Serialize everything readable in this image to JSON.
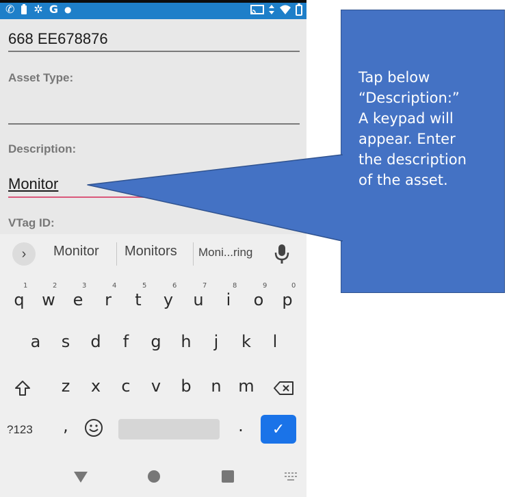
{
  "status_bar": {
    "left_icons": [
      "phone-icon",
      "battery-saver-icon",
      "gear-icon",
      "google-icon",
      "dot-icon"
    ],
    "google_letter": "G",
    "right_icons": [
      "cast-icon",
      "data-transfer-icon",
      "wifi-icon",
      "battery-icon"
    ]
  },
  "form": {
    "serial_value": "668 EE678876",
    "asset_type_label": "Asset Type:",
    "asset_type_value": "",
    "description_label": "Description:",
    "description_value": "Monitor",
    "vtag_label": "VTag ID:"
  },
  "keyboard": {
    "suggestions": [
      "Monitor",
      "Monitors",
      "Moni...ring"
    ],
    "row1": [
      "q",
      "w",
      "e",
      "r",
      "t",
      "y",
      "u",
      "i",
      "o",
      "p"
    ],
    "row1_hints": [
      "1",
      "2",
      "3",
      "4",
      "5",
      "6",
      "7",
      "8",
      "9",
      "0"
    ],
    "row2": [
      "a",
      "s",
      "d",
      "f",
      "g",
      "h",
      "j",
      "k",
      "l"
    ],
    "row3": [
      "z",
      "x",
      "c",
      "v",
      "b",
      "n",
      "m"
    ],
    "symbols_label": "?123",
    "comma": ",",
    "period": ".",
    "enter_glyph": "✓"
  },
  "callout": {
    "lines": [
      "Tap below",
      "“Description:”",
      "A keypad will",
      "appear. Enter",
      "the description",
      "of the asset."
    ],
    "fill_color": "#4472c4"
  },
  "colors": {
    "status_bar": "#1e7fc9",
    "focus_underline": "#d9577a",
    "enter_key": "#1a73e8"
  }
}
